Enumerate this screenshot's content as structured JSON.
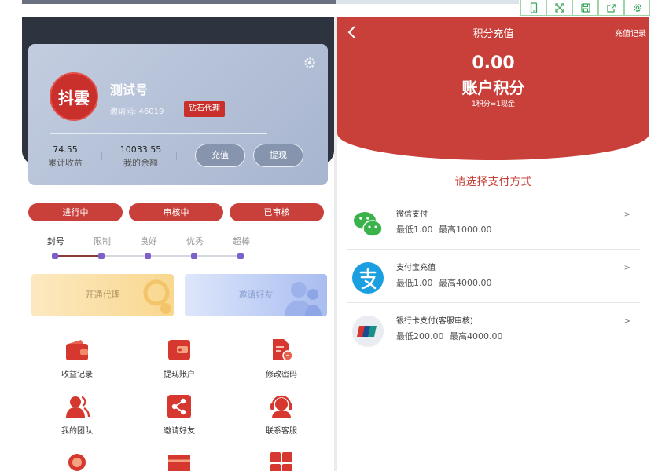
{
  "colors": {
    "brand_red": "#c9403a",
    "dark_header": "#2d3440",
    "level_dot": "#7b61c9",
    "toolbar_border": "#9ad6a6"
  },
  "toolbar": {
    "icons": [
      "phone-icon",
      "fullscreen-icon",
      "save-icon",
      "share-icon",
      "settings-icon"
    ]
  },
  "profile": {
    "logo_text": "抖雲",
    "name": "测试号",
    "invite_code": "邀请码: 46019",
    "badge": "钻石代理",
    "earnings_value": "74.55",
    "earnings_label": "累计收益",
    "balance_value": "10033.55",
    "balance_label": "我的余额",
    "recharge_button": "充值",
    "withdraw_button": "提现"
  },
  "status_tabs": [
    "进行中",
    "审核中",
    "已审核"
  ],
  "levels": {
    "labels": [
      "封号",
      "限制",
      "良好",
      "优秀",
      "超棒"
    ],
    "current_index": 1
  },
  "banners": {
    "open_agent": "开通代理",
    "invite_friends": "邀请好友"
  },
  "menu": [
    {
      "label": "收益记录",
      "icon": "wallet-icon"
    },
    {
      "label": "提现账户",
      "icon": "card-wallet-icon"
    },
    {
      "label": "修改密码",
      "icon": "document-edit-icon"
    },
    {
      "label": "我的团队",
      "icon": "team-icon"
    },
    {
      "label": "邀请好友",
      "icon": "share-icon"
    },
    {
      "label": "联系客服",
      "icon": "customer-service-icon"
    }
  ],
  "recharge": {
    "title": "积分充值",
    "history_link": "充值记录",
    "points_value": "0.00",
    "points_label": "账户积分",
    "rate": "1积分=1现金",
    "choose_label": "请选择支付方式",
    "methods": [
      {
        "name": "微信支付",
        "min": "最低1.00",
        "max": "最高1000.00",
        "icon": "wechat-icon",
        "arrow": ">"
      },
      {
        "name": "支付宝充值",
        "min": "最低1.00",
        "max": "最高4000.00",
        "icon": "alipay-icon",
        "arrow": ">"
      },
      {
        "name": "银行卡支付(客服审核)",
        "min": "最低200.00",
        "max": "最高4000.00",
        "icon": "unionpay-icon",
        "arrow": ">"
      }
    ]
  }
}
